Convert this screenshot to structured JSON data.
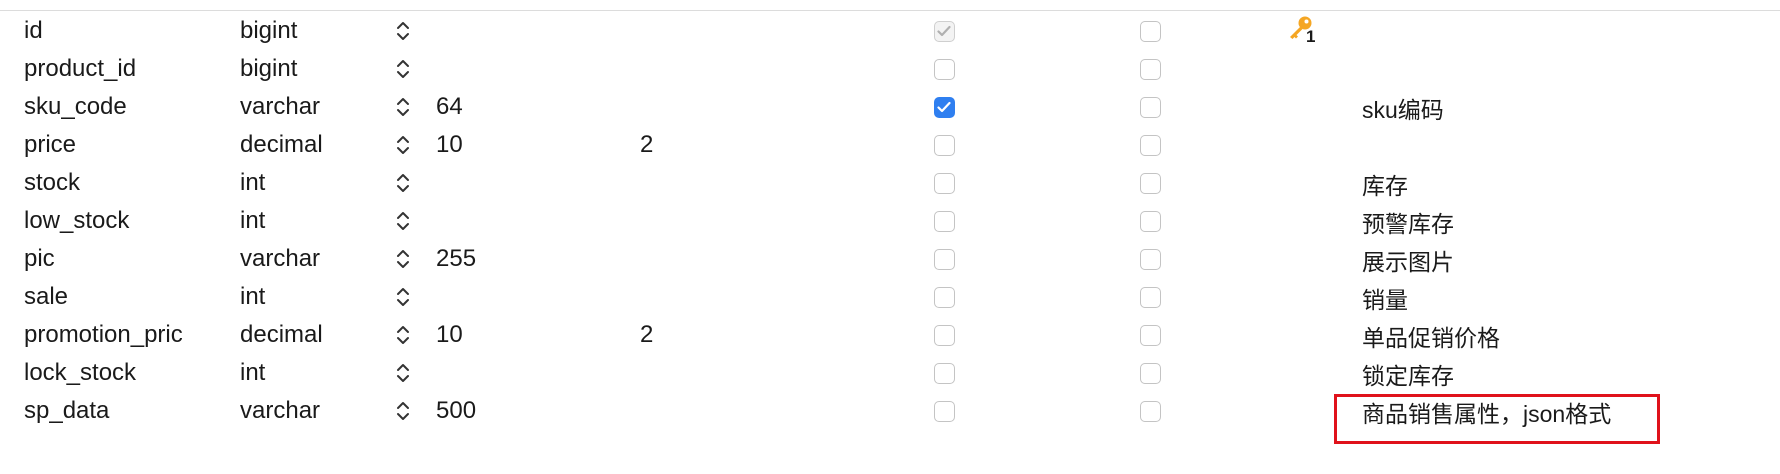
{
  "columns": [
    {
      "name": "id",
      "type": "bigint",
      "length": "",
      "decimals": "",
      "not_null": true,
      "not_null_disabled": true,
      "virtual": false,
      "key": "1",
      "comment": ""
    },
    {
      "name": "product_id",
      "type": "bigint",
      "length": "",
      "decimals": "",
      "not_null": false,
      "not_null_disabled": false,
      "virtual": false,
      "key": "",
      "comment": ""
    },
    {
      "name": "sku_code",
      "type": "varchar",
      "length": "64",
      "decimals": "",
      "not_null": true,
      "not_null_disabled": false,
      "virtual": false,
      "key": "",
      "comment": "sku编码"
    },
    {
      "name": "price",
      "type": "decimal",
      "length": "10",
      "decimals": "2",
      "not_null": false,
      "not_null_disabled": false,
      "virtual": false,
      "key": "",
      "comment": ""
    },
    {
      "name": "stock",
      "type": "int",
      "length": "",
      "decimals": "",
      "not_null": false,
      "not_null_disabled": false,
      "virtual": false,
      "key": "",
      "comment": "库存"
    },
    {
      "name": "low_stock",
      "type": "int",
      "length": "",
      "decimals": "",
      "not_null": false,
      "not_null_disabled": false,
      "virtual": false,
      "key": "",
      "comment": "预警库存"
    },
    {
      "name": "pic",
      "type": "varchar",
      "length": "255",
      "decimals": "",
      "not_null": false,
      "not_null_disabled": false,
      "virtual": false,
      "key": "",
      "comment": "展示图片"
    },
    {
      "name": "sale",
      "type": "int",
      "length": "",
      "decimals": "",
      "not_null": false,
      "not_null_disabled": false,
      "virtual": false,
      "key": "",
      "comment": "销量"
    },
    {
      "name": "promotion_pric",
      "type": "decimal",
      "length": "10",
      "decimals": "2",
      "not_null": false,
      "not_null_disabled": false,
      "virtual": false,
      "key": "",
      "comment": "单品促销价格"
    },
    {
      "name": "lock_stock",
      "type": "int",
      "length": "",
      "decimals": "",
      "not_null": false,
      "not_null_disabled": false,
      "virtual": false,
      "key": "",
      "comment": "锁定库存"
    },
    {
      "name": "sp_data",
      "type": "varchar",
      "length": "500",
      "decimals": "",
      "not_null": false,
      "not_null_disabled": false,
      "virtual": false,
      "key": "",
      "comment": "商品销售属性，json格式"
    }
  ],
  "icons": {
    "type_stepper": "updown-chevron-icon",
    "primary_key": "key-icon",
    "checkmark": "checkmark-icon"
  },
  "colors": {
    "checkbox_checked": "#2f7ff0",
    "key": "#f5a623",
    "highlight": "#e0121b"
  }
}
